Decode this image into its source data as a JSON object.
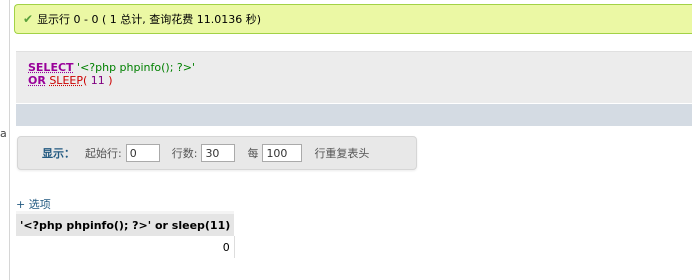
{
  "left_panel": {
    "fragment": "a"
  },
  "success_message": {
    "icon": "check-icon",
    "text": "显示行 0 - 0 ( 1 总计, 查询花费 11.0136 秒)"
  },
  "sql_query": {
    "select_kw": "SELECT",
    "string_literal": " '<?php phpinfo(); ?>'",
    "or_kw": "OR",
    "sleep_fn": "SLEEP",
    "paren_open": "( ",
    "arg": "11",
    "paren_close": " )"
  },
  "navigation": {
    "show_label": "显示：",
    "start_row_label": "起始行:",
    "start_row_value": "0",
    "rows_label": "行数:",
    "rows_value": "30",
    "per_label": "每",
    "repeat_headers_value": "100",
    "repeat_headers_label": "行重复表头"
  },
  "options_link": "+ 选项",
  "result_table": {
    "columns": [
      "'<?php phpinfo(); ?>' or sleep(11)"
    ],
    "rows": [
      [
        "0"
      ]
    ]
  },
  "colors": {
    "success_bg": "#ebf8a4",
    "link": "#235a81",
    "keyword": "#990099",
    "string": "#008000",
    "function": "#cc0000"
  }
}
